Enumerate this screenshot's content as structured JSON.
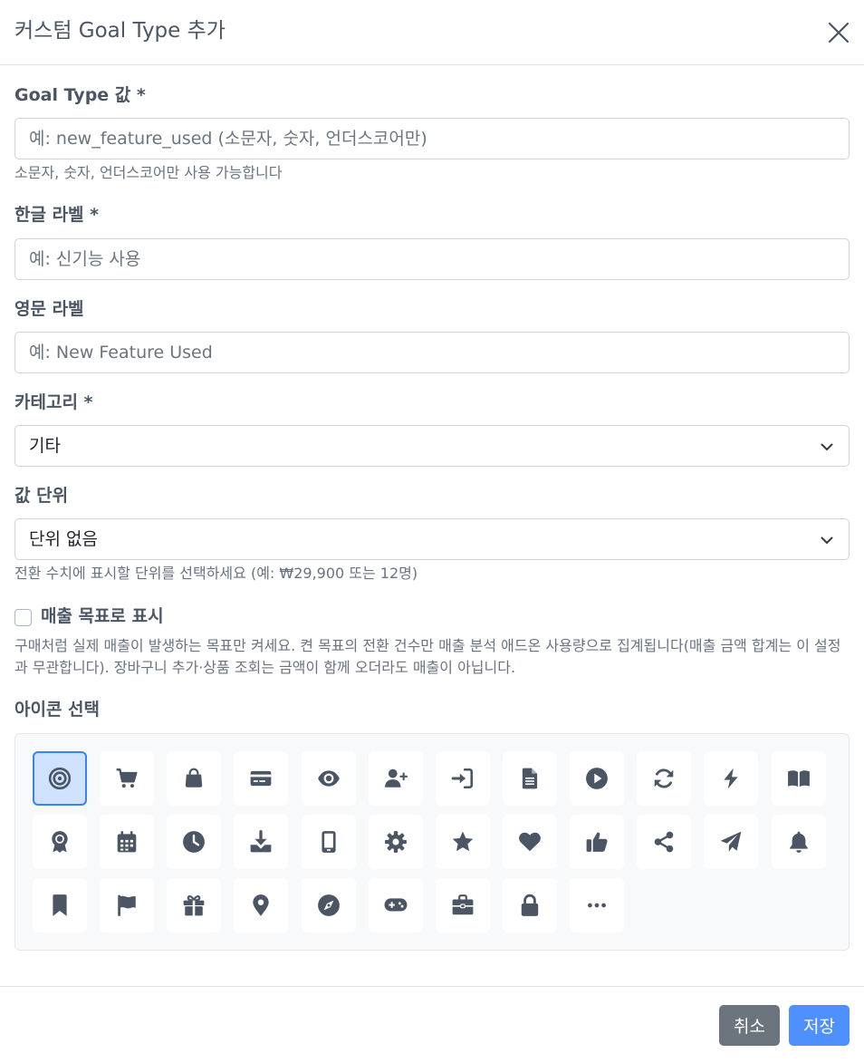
{
  "modal": {
    "title": "커스텀 Goal Type 추가"
  },
  "form": {
    "goal_type": {
      "label": "Goal Type 값 *",
      "placeholder": "예: new_feature_used (소문자, 숫자, 언더스코어만)",
      "value": "",
      "help": "소문자, 숫자, 언더스코어만 사용 가능합니다"
    },
    "label_ko": {
      "label": "한글 라벨 *",
      "placeholder": "예: 신기능 사용",
      "value": ""
    },
    "label_en": {
      "label": "영문 라벨",
      "placeholder": "예: New Feature Used",
      "value": ""
    },
    "category": {
      "label": "카테고리 *",
      "selected": "기타"
    },
    "value_unit": {
      "label": "값 단위",
      "selected": "단위 없음",
      "help": "전환 수치에 표시할 단위를 선택하세요 (예: ₩29,900 또는 12명)"
    },
    "revenue_goal": {
      "label": "매출 목표로 표시",
      "checked": false,
      "help": "구매처럼 실제 매출이 발생하는 목표만 켜세요. 켠 목표의 전환 건수만 매출 분석 애드온 사용량으로 집계됩니다(매출 금액 합계는 이 설정과 무관합니다). 장바구니 추가·상품 조회는 금액이 함께 오더라도 매출이 아닙니다."
    },
    "icon_select": {
      "label": "아이콘 선택",
      "selected": "target-icon",
      "icons": [
        "target-icon",
        "cart-icon",
        "shopping-bag-icon",
        "credit-card-icon",
        "eye-icon",
        "user-plus-icon",
        "sign-in-icon",
        "file-icon",
        "play-icon",
        "refresh-icon",
        "bolt-icon",
        "book-icon",
        "award-icon",
        "calendar-icon",
        "clock-icon",
        "download-icon",
        "mobile-icon",
        "gear-icon",
        "star-icon",
        "heart-icon",
        "thumbs-up-icon",
        "share-icon",
        "paper-plane-icon",
        "bell-icon",
        "bookmark-icon",
        "flag-icon",
        "gift-icon",
        "map-pin-icon",
        "compass-icon",
        "gamepad-icon",
        "briefcase-icon",
        "lock-icon",
        "more-icon"
      ]
    }
  },
  "footer": {
    "cancel_label": "취소",
    "save_label": "저장"
  },
  "colors": {
    "primary": "#4d90fe",
    "secondary": "#6c757d",
    "selected_bg": "#cfe2ff",
    "selected_border": "#3b82f6",
    "icon": "#4b5563"
  }
}
